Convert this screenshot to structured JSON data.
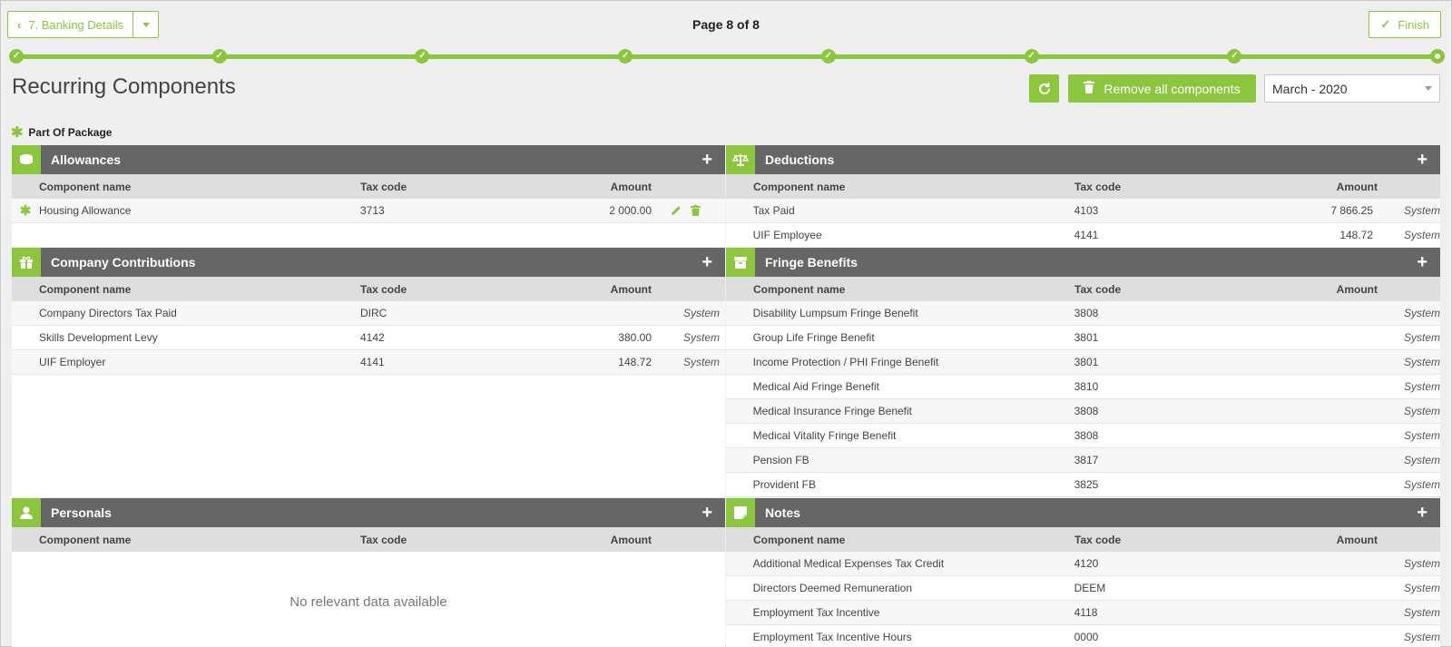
{
  "nav": {
    "back_label": "7. Banking Details",
    "page_indicator": "Page 8 of 8",
    "finish_label": "Finish",
    "accent_color": "#8cc63f",
    "steps": 8,
    "current_step": 8
  },
  "header": {
    "title": "Recurring Components",
    "remove_all_label": "Remove all components",
    "period_value": "March - 2020",
    "legend_label": "Part Of Package"
  },
  "columns": {
    "name": "Component name",
    "tax": "Tax code",
    "amount": "Amount"
  },
  "panels": {
    "allowances": {
      "title": "Allowances",
      "icon": "coins-icon",
      "rows": [
        {
          "part_of_package": true,
          "name": "Housing Allowance",
          "tax": "3713",
          "amount": "2 000.00",
          "source": ""
        }
      ]
    },
    "deductions": {
      "title": "Deductions",
      "icon": "scales-icon",
      "rows": [
        {
          "name": "Tax Paid",
          "tax": "4103",
          "amount": "7 866.25",
          "source": "System"
        },
        {
          "name": "UIF Employee",
          "tax": "4141",
          "amount": "148.72",
          "source": "System"
        }
      ]
    },
    "company_contributions": {
      "title": "Company Contributions",
      "icon": "gift-icon",
      "rows": [
        {
          "name": "Company Directors Tax Paid",
          "tax": "DIRC",
          "amount": "",
          "source": "System"
        },
        {
          "name": "Skills Development Levy",
          "tax": "4142",
          "amount": "380.00",
          "source": "System"
        },
        {
          "name": "UIF Employer",
          "tax": "4141",
          "amount": "148.72",
          "source": "System"
        }
      ]
    },
    "fringe_benefits": {
      "title": "Fringe Benefits",
      "icon": "box-icon",
      "rows": [
        {
          "name": "Disability Lumpsum Fringe Benefit",
          "tax": "3808",
          "amount": "",
          "source": "System"
        },
        {
          "name": "Group Life Fringe Benefit",
          "tax": "3801",
          "amount": "",
          "source": "System"
        },
        {
          "name": "Income Protection / PHI Fringe Benefit",
          "tax": "3801",
          "amount": "",
          "source": "System"
        },
        {
          "name": "Medical Aid Fringe Benefit",
          "tax": "3810",
          "amount": "",
          "source": "System"
        },
        {
          "name": "Medical Insurance Fringe Benefit",
          "tax": "3808",
          "amount": "",
          "source": "System"
        },
        {
          "name": "Medical Vitality Fringe Benefit",
          "tax": "3808",
          "amount": "",
          "source": "System"
        },
        {
          "name": "Pension FB",
          "tax": "3817",
          "amount": "",
          "source": "System"
        },
        {
          "name": "Provident FB",
          "tax": "3825",
          "amount": "",
          "source": "System"
        }
      ]
    },
    "personals": {
      "title": "Personals",
      "icon": "user-icon",
      "empty_message": "No relevant data available",
      "rows": []
    },
    "notes": {
      "title": "Notes",
      "icon": "note-icon",
      "rows": [
        {
          "name": "Additional Medical Expenses Tax Credit",
          "tax": "4120",
          "amount": "",
          "source": "System"
        },
        {
          "name": "Directors Deemed Remuneration",
          "tax": "DEEM",
          "amount": "",
          "source": "System"
        },
        {
          "name": "Employment Tax Incentive",
          "tax": "4118",
          "amount": "",
          "source": "System"
        },
        {
          "name": "Employment Tax Incentive Hours",
          "tax": "0000",
          "amount": "",
          "source": "System"
        }
      ]
    }
  }
}
